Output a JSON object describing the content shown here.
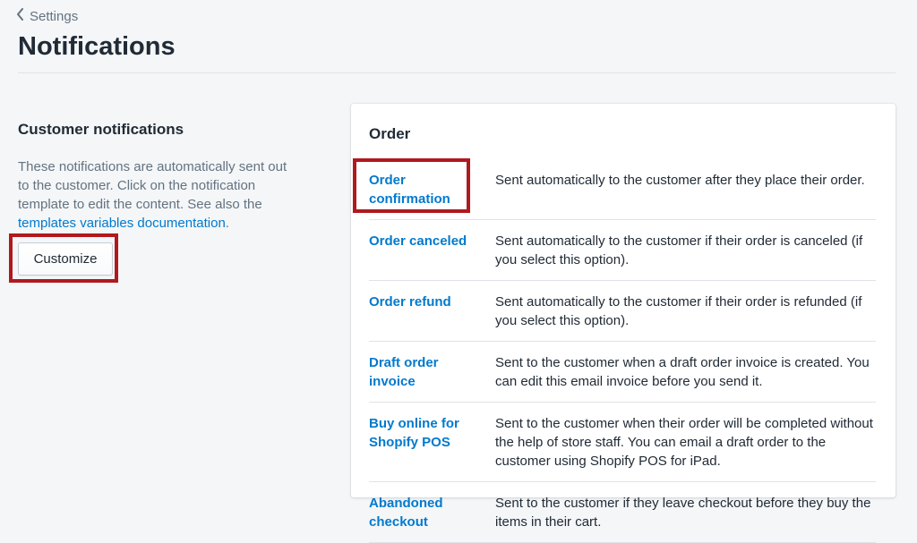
{
  "breadcrumb": {
    "label": "Settings",
    "icon": "chevron-left-icon"
  },
  "page": {
    "title": "Notifications"
  },
  "customer_section": {
    "title": "Customer notifications",
    "description": "These notifications are automatically sent out to the customer. Click on the notification template to edit the content. See also the ",
    "link_text": "templates variables documentation",
    "description_end": ".",
    "customize_label": "Customize"
  },
  "order_card": {
    "title": "Order",
    "rows": [
      {
        "name": "Order confirmation",
        "desc": "Sent automatically to the customer after they place their order."
      },
      {
        "name": "Order canceled",
        "desc": "Sent automatically to the customer if their order is canceled (if you select this option)."
      },
      {
        "name": "Order refund",
        "desc": "Sent automatically to the customer if their order is refunded (if you select this option)."
      },
      {
        "name": "Draft order invoice",
        "desc": "Sent to the customer when a draft order invoice is created. You can edit this email invoice before you send it."
      },
      {
        "name": "Buy online for Shopify POS",
        "desc": "Sent to the customer when their order will be completed without the help of store staff. You can email a draft order to the customer using Shopify POS for iPad."
      },
      {
        "name": "Abandoned checkout",
        "desc": "Sent to the customer if they leave checkout before they buy the items in their cart."
      }
    ]
  },
  "colors": {
    "link": "#007ace",
    "highlight": "#b0191e",
    "background": "#f4f6f8"
  }
}
